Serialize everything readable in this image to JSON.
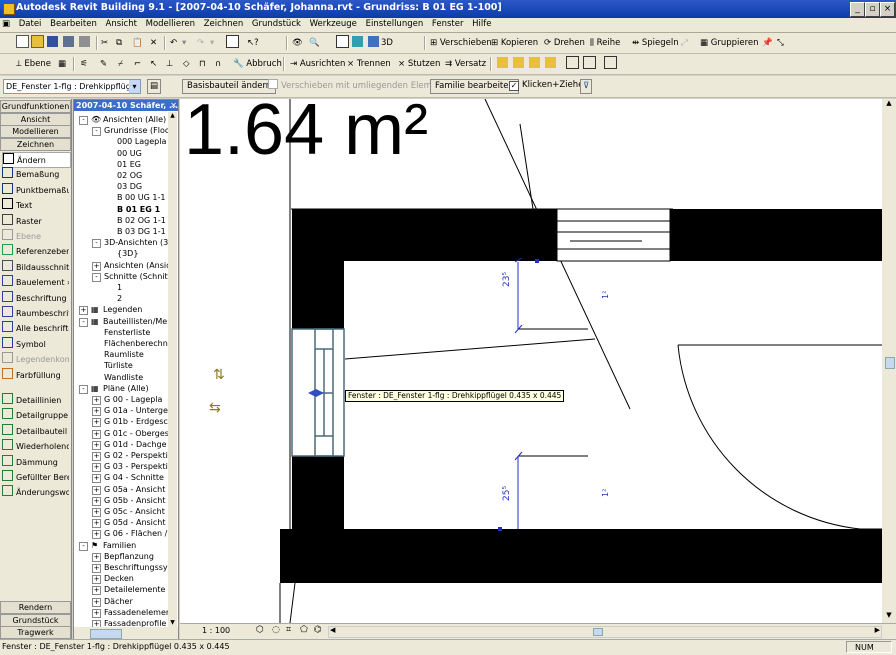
{
  "window": {
    "title": "Autodesk Revit Building 9.1 - [2007-04-10 Schäfer, Johanna.rvt - Grundriss: B 01 EG 1-100]"
  },
  "menu": [
    "Datei",
    "Bearbeiten",
    "Ansicht",
    "Modellieren",
    "Zeichnen",
    "Grundstück",
    "Werkzeuge",
    "Einstellungen",
    "Fenster",
    "Hilfe"
  ],
  "toolbar1": {
    "three_d": "3D",
    "verschieben": "Verschieben",
    "kopieren": "Kopieren",
    "drehen": "Drehen",
    "reihe": "Reihe",
    "spiegeln": "Spiegeln",
    "gruppieren": "Gruppieren"
  },
  "toolbar2": {
    "ebene": "Ebene",
    "abbruch": "Abbruch",
    "ausrichten": "Ausrichten",
    "trennen": "Trennen",
    "stutzen": "Stutzen",
    "versatz": "Versatz"
  },
  "optionsbar": {
    "type_selector": "DE_Fenster 1-flg : Drehkippflügel 0.4",
    "basisbauteil": "Basisbauteil ändern",
    "verschieben_unliegend": "Verschieben mit umliegenden Elementen",
    "familie": "Familie bearbeiten",
    "klicken_ziehen": "Klicken+Ziehen"
  },
  "design_bar": {
    "tabs_top": [
      "Grundfunktionen",
      "Ansicht",
      "Modellieren",
      "Zeichnen"
    ],
    "tools": [
      {
        "label": "Ändern",
        "icon": "arrow-cursor-icon",
        "enabled": true
      },
      {
        "label": "Bemaßung",
        "icon": "dimension-icon",
        "enabled": true
      },
      {
        "label": "Punktbemaßung",
        "icon": "spot-dimension-icon",
        "enabled": true
      },
      {
        "label": "Text",
        "icon": "text-t-icon",
        "enabled": true
      },
      {
        "label": "Raster",
        "icon": "grid-icon",
        "enabled": true
      },
      {
        "label": "Ebene",
        "icon": "level-icon",
        "enabled": false
      },
      {
        "label": "Referenzebene",
        "icon": "ref-plane-icon",
        "enabled": true
      },
      {
        "label": "Bildausschnitt",
        "icon": "crop-icon",
        "enabled": true
      },
      {
        "label": "Bauelement »",
        "icon": "component-icon",
        "enabled": true
      },
      {
        "label": "Beschriftung »",
        "icon": "tag-icon",
        "enabled": true
      },
      {
        "label": "Raumbeschrift.",
        "icon": "room-tag-icon",
        "enabled": true
      },
      {
        "label": "Alle beschriften",
        "icon": "tag-all-icon",
        "enabled": true
      },
      {
        "label": "Symbol",
        "icon": "symbol-icon",
        "enabled": true
      },
      {
        "label": "Legendenkomp",
        "icon": "legend-icon",
        "enabled": false
      },
      {
        "label": "Farbfüllung",
        "icon": "color-fill-icon",
        "enabled": true
      },
      {
        "label": "Detaillinien",
        "icon": "detail-line-icon",
        "enabled": true
      },
      {
        "label": "Detailgruppe",
        "icon": "detail-group-icon",
        "enabled": true
      },
      {
        "label": "Detailbauteil",
        "icon": "detail-component-icon",
        "enabled": true
      },
      {
        "label": "Wiederholende",
        "icon": "repeating-detail-icon",
        "enabled": true
      },
      {
        "label": "Dämmung",
        "icon": "insulation-icon",
        "enabled": true
      },
      {
        "label": "Gefüllter Bereic",
        "icon": "filled-region-icon",
        "enabled": true
      },
      {
        "label": "Änderungswolk",
        "icon": "revision-cloud-icon",
        "enabled": true
      }
    ],
    "tabs_bottom": [
      "Rendern",
      "Grundstück",
      "Tragwerk"
    ]
  },
  "project_browser": {
    "title": "2007-04-10 Schäfer, ...",
    "nodes": [
      {
        "label": "Ansichten (Alle)",
        "level": 0,
        "toggle": "-",
        "icon": "eye"
      },
      {
        "label": "Grundrisse (Floor",
        "level": 1,
        "toggle": "-"
      },
      {
        "label": "000 Lagepla",
        "level": 2
      },
      {
        "label": "00 UG",
        "level": 2
      },
      {
        "label": "01 EG",
        "level": 2
      },
      {
        "label": "02 OG",
        "level": 2
      },
      {
        "label": "03 DG",
        "level": 2
      },
      {
        "label": "B 00 UG 1-1",
        "level": 2
      },
      {
        "label": "B 01 EG 1",
        "level": 2,
        "bold": true
      },
      {
        "label": "B 02 OG 1-1",
        "level": 2
      },
      {
        "label": "B 03 DG 1-1",
        "level": 2
      },
      {
        "label": "3D-Ansichten (3D",
        "level": 1,
        "toggle": "-"
      },
      {
        "label": "{3D}",
        "level": 2
      },
      {
        "label": "Ansichten (Ansic",
        "level": 1,
        "toggle": "+"
      },
      {
        "label": "Schnitte (Schnitt",
        "level": 1,
        "toggle": "-"
      },
      {
        "label": "1",
        "level": 2
      },
      {
        "label": "2",
        "level": 2
      },
      {
        "label": "Legenden",
        "level": 0,
        "toggle": "+",
        "icon": "grid"
      },
      {
        "label": "Bauteillisten/Men",
        "level": 0,
        "toggle": "-",
        "icon": "grid"
      },
      {
        "label": "Fensterliste",
        "level": 1
      },
      {
        "label": "Flächenberechn",
        "level": 1
      },
      {
        "label": "Raumliste",
        "level": 1
      },
      {
        "label": "Türliste",
        "level": 1
      },
      {
        "label": "Wandliste",
        "level": 1
      },
      {
        "label": "Pläne (Alle)",
        "level": 0,
        "toggle": "-",
        "icon": "sheet"
      },
      {
        "label": "G 00 - Lagepla",
        "level": 1,
        "toggle": "+"
      },
      {
        "label": "G 01a - Unterge",
        "level": 1,
        "toggle": "+"
      },
      {
        "label": "G 01b - Erdgesc",
        "level": 1,
        "toggle": "+"
      },
      {
        "label": "G 01c - Oberges",
        "level": 1,
        "toggle": "+"
      },
      {
        "label": "G 01d - Dachge",
        "level": 1,
        "toggle": "+"
      },
      {
        "label": "G 02 - Perspekti",
        "level": 1,
        "toggle": "+"
      },
      {
        "label": "G 03 - Perspekti",
        "level": 1,
        "toggle": "+"
      },
      {
        "label": "G 04 - Schnitte",
        "level": 1,
        "toggle": "+"
      },
      {
        "label": "G 05a - Ansicht",
        "level": 1,
        "toggle": "+"
      },
      {
        "label": "G 05b - Ansicht",
        "level": 1,
        "toggle": "+"
      },
      {
        "label": "G 05c - Ansicht",
        "level": 1,
        "toggle": "+"
      },
      {
        "label": "G 05d - Ansicht",
        "level": 1,
        "toggle": "+"
      },
      {
        "label": "G 06 - Flächen /",
        "level": 1,
        "toggle": "+"
      },
      {
        "label": "Familien",
        "level": 0,
        "toggle": "-",
        "icon": "family"
      },
      {
        "label": "Bepflanzung",
        "level": 1,
        "toggle": "+"
      },
      {
        "label": "Beschriftungssy",
        "level": 1,
        "toggle": "+"
      },
      {
        "label": "Decken",
        "level": 1,
        "toggle": "+"
      },
      {
        "label": "Detailelemente",
        "level": 1,
        "toggle": "+"
      },
      {
        "label": "Dächer",
        "level": 1,
        "toggle": "+"
      },
      {
        "label": "Fassadenelemer",
        "level": 1,
        "toggle": "+"
      },
      {
        "label": "Fassadenprofile",
        "level": 1,
        "toggle": "+"
      }
    ]
  },
  "drawing": {
    "area_label": "1.64 m²",
    "dim_upper": "23⁵",
    "dim_lower": "25⁵",
    "sill_upper": "1²",
    "sill_lower": "1²",
    "tooltip": "Fenster : DE_Fenster 1-flg : Drehkippflügel 0.435 x 0.445"
  },
  "view_control": {
    "scale": "1 : 100"
  },
  "status": {
    "text": "Fenster : DE_Fenster 1-flg : Drehkippflügel 0.435 x 0.445",
    "num": "NUM"
  }
}
